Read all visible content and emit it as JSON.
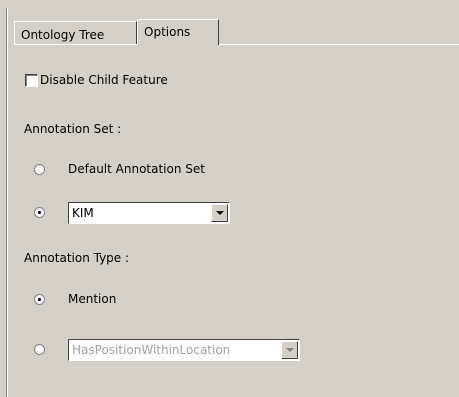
{
  "tabs": [
    {
      "label": "Ontology Tree"
    },
    {
      "label": "Options"
    }
  ],
  "options": {
    "disable_child_feature": {
      "label": "Disable Child Feature",
      "checked": false
    },
    "annotation_set": {
      "label": "Annotation Set :",
      "default_option": {
        "label": "Default Annotation Set",
        "selected": false
      },
      "custom_option": {
        "selected": true,
        "value": "KIM"
      }
    },
    "annotation_type": {
      "label": "Annotation Type :",
      "mention_option": {
        "label": "Mention",
        "selected": true
      },
      "custom_option": {
        "selected": false,
        "value": "HasPositionWithinLocation",
        "disabled": true
      }
    }
  }
}
